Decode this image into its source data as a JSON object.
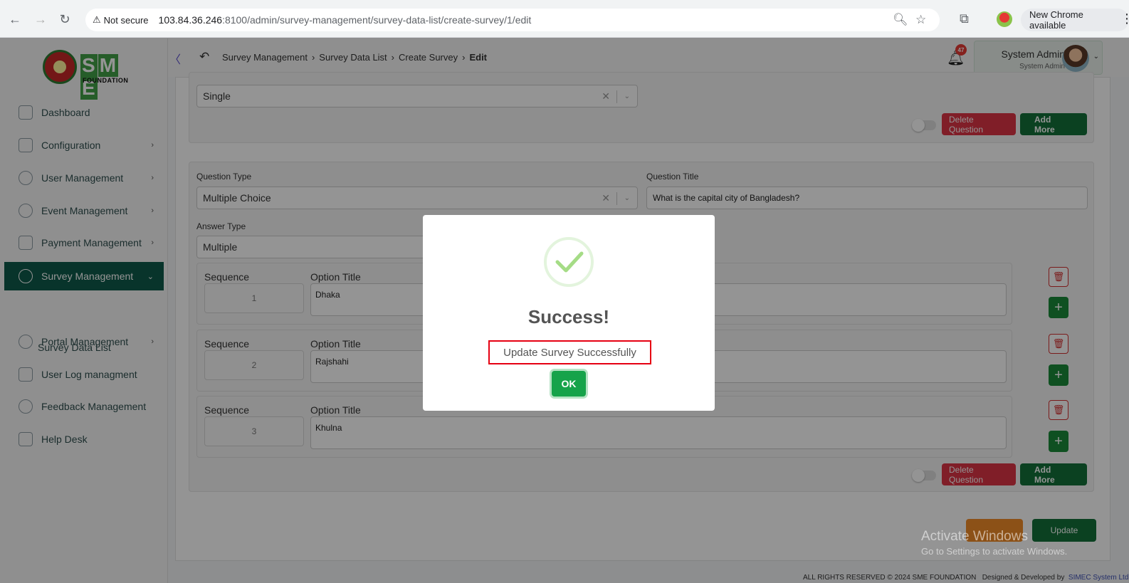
{
  "browser": {
    "security_label": "Not secure",
    "url_host": "103.84.36.246",
    "url_rest": ":8100/admin/survey-management/survey-data-list/create-survey/1/edit",
    "new_chrome_label": "New Chrome available"
  },
  "logo": {
    "letters": [
      "S",
      "M",
      "E"
    ],
    "subtitle": "FOUNDATION"
  },
  "sidebar": {
    "items": [
      {
        "label": "Dashboard",
        "chevron": ""
      },
      {
        "label": "Configuration",
        "chevron": "›"
      },
      {
        "label": "User Management",
        "chevron": "›"
      },
      {
        "label": "Event Management",
        "chevron": "›"
      },
      {
        "label": "Payment Management",
        "chevron": "›"
      },
      {
        "label": "Survey Management",
        "chevron": "⌄"
      },
      {
        "label": "Portal Management",
        "chevron": "›"
      },
      {
        "label": "User Log managment",
        "chevron": ""
      },
      {
        "label": "Feedback Management",
        "chevron": ""
      },
      {
        "label": "Help Desk",
        "chevron": ""
      }
    ],
    "sub_item": "Survey Data List",
    "collapse_icon": "〈"
  },
  "header": {
    "breadcrumb": [
      "Survey Management",
      "Survey Data List",
      "Create Survey",
      "Edit"
    ],
    "notification_count": "47",
    "user_name": "System Admin",
    "user_role": "System Admin"
  },
  "question1": {
    "answer_type_value": "Single",
    "delete_label": "Delete Question",
    "add_more_label": "Add More"
  },
  "question2": {
    "question_type_label": "Question Type",
    "question_type_value": "Multiple Choice",
    "question_title_label": "Question Title",
    "question_title_value": "What is the capital city of Bangladesh?",
    "answer_type_label": "Answer Type",
    "answer_type_value": "Multiple",
    "options": [
      {
        "seq_label": "Sequence",
        "seq": "1",
        "title_label": "Option Title",
        "title": "Dhaka"
      },
      {
        "seq_label": "Sequence",
        "seq": "2",
        "title_label": "Option Title",
        "title": "Rajshahi"
      },
      {
        "seq_label": "Sequence",
        "seq": "3",
        "title_label": "Option Title",
        "title": "Khulna"
      }
    ],
    "delete_label": "Delete Question",
    "add_more_label": "Add More"
  },
  "form_actions": {
    "update_label": "Update"
  },
  "footer": {
    "copyright": "ALL RIGHTS RESERVED © 2024 SME FOUNDATION",
    "developed_by": "Designed & Developed by",
    "developer": "SIMEC System Ltd."
  },
  "modal": {
    "title": "Success!",
    "message": "Update Survey Successfully",
    "ok_label": "OK"
  },
  "watermark": {
    "line1": "Activate Windows",
    "line2": "Go to Settings to activate Windows."
  },
  "colors": {
    "brand_green": "#0f5a4a",
    "success": "#16a34a",
    "danger": "#dc3545",
    "highlight_box": "#e60012"
  }
}
